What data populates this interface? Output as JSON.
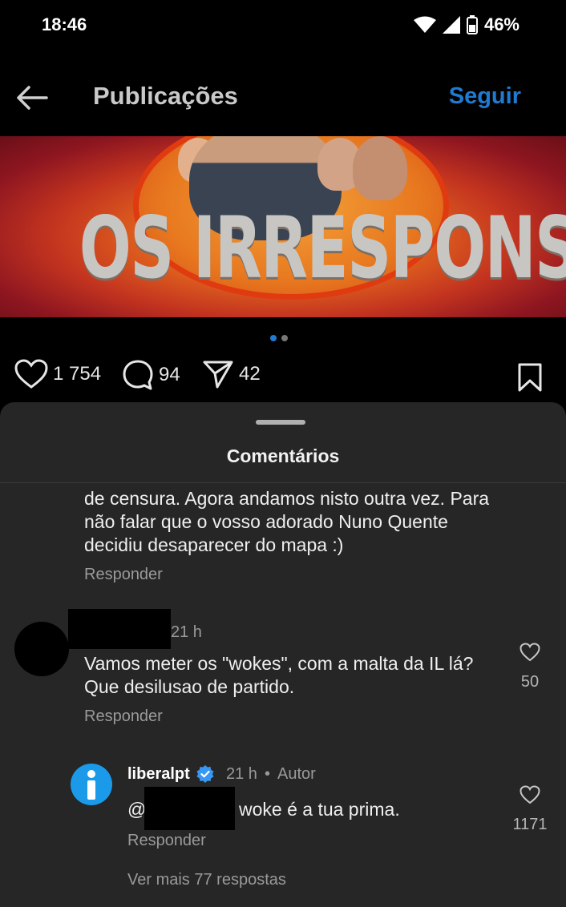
{
  "status": {
    "time": "18:46",
    "battery": "46%"
  },
  "appbar": {
    "title": "Publicações",
    "follow_label": "Seguir"
  },
  "banner": {
    "text": "OS IRRESPONSÁVEIS"
  },
  "actions": {
    "likes": "1 754",
    "comments": "94",
    "shares": "42"
  },
  "colors": {
    "accent": "#1f7bd1",
    "sheet": "#262626",
    "verified": "#3897f0"
  },
  "sheet": {
    "title": "Comentários"
  },
  "comments": [
    {
      "text": "de censura. Agora andamos nisto outra vez. Para não falar que o vosso adorado Nuno Quente decidiu desaparecer do mapa :)",
      "reply_label": "Responder"
    },
    {
      "time": "21 h",
      "text": "Vamos meter os \"wokes\", com a malta da IL lá? Que desilusao de partido.",
      "reply_label": "Responder",
      "likes": "50"
    },
    {
      "username": "liberalpt",
      "time": "21 h",
      "author_label": "Autor",
      "mention_prefix": "@",
      "text": "woke é a tua prima.",
      "reply_label": "Responder",
      "likes": "1171"
    }
  ],
  "more_replies": "Ver mais 77 respostas"
}
